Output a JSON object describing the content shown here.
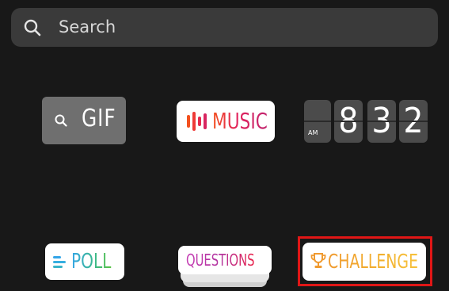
{
  "search": {
    "placeholder": "Search"
  },
  "stickers": {
    "gif": {
      "label": "GIF"
    },
    "music": {
      "label": "MUSIC"
    },
    "clock": {
      "meridiem": "AM",
      "digits": [
        "8",
        "3",
        "2"
      ]
    },
    "poll": {
      "label": "POLL"
    },
    "questions": {
      "label": "QUESTIONS"
    },
    "challenge": {
      "label": "CHALLENGE"
    }
  },
  "highlight": {
    "target": "challenge",
    "color": "#e01616"
  },
  "colors": {
    "background": "#181818",
    "search_bg": "#3a3a3a"
  }
}
